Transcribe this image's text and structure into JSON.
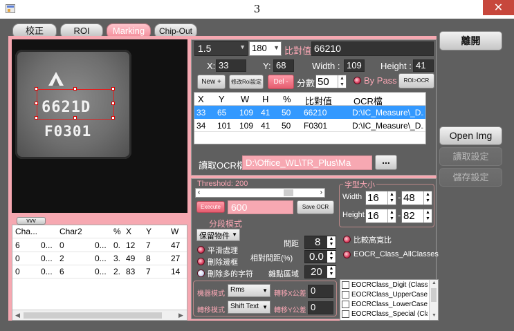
{
  "window": {
    "title": "3",
    "close_glyph": "✕"
  },
  "tabs": [
    {
      "label": "校正",
      "active": false
    },
    {
      "label": "ROI",
      "active": false
    },
    {
      "label": "Marking",
      "active": true
    },
    {
      "label": "Chip-Out",
      "active": false
    }
  ],
  "side_buttons": {
    "exit": "離開",
    "open_img": "Open Img",
    "read_settings": "讀取設定",
    "save_settings": "儲存設定"
  },
  "image": {
    "logo_char": "A",
    "line1": "6621D",
    "line2": "F0301"
  },
  "left_panel": {
    "collapse_label": "vvv",
    "columns": [
      "Cha...",
      "",
      "Char2",
      "",
      "%",
      "X",
      "Y",
      "W"
    ],
    "rows": [
      [
        "6",
        "0...",
        "0",
        "0...",
        "0.",
        "12",
        "7",
        "47"
      ],
      [
        "0",
        "0...",
        "2",
        "0...",
        "3.",
        "49",
        "8",
        "27"
      ],
      [
        "0",
        "0...",
        "6",
        "0...",
        "2.",
        "83",
        "7",
        "14"
      ]
    ]
  },
  "top_panel": {
    "value_dropdown": "1.5",
    "angle_dropdown": "180",
    "compare_label": "比對值",
    "compare_value": "66210",
    "x_label": "X:",
    "x_value": "33",
    "y_label": "Y:",
    "y_value": "68",
    "width_label": "Width :",
    "width_value": "109",
    "height_label": "Height :",
    "height_value": "41",
    "new_button": "New +",
    "modify_roi_button": "修改Roi設定",
    "del_button": "Del -",
    "score_label": "分數",
    "score_value": "50",
    "bypass_label": "By Pass",
    "roi_ocr_button": "ROI>OCR",
    "grid_columns": [
      "X",
      "Y",
      "W",
      "H",
      "%",
      "比對值",
      "OCR檔"
    ],
    "grid_rows": [
      [
        "33",
        "65",
        "109",
        "41",
        "50",
        "66210",
        "D:\\IC_Measure\\_D..."
      ],
      [
        "34",
        "101",
        "109",
        "41",
        "50",
        "F0301",
        "D:\\IC_Measure\\_D..."
      ]
    ],
    "read_ocr_label": "讀取OCR檔",
    "ocr_path": "D:\\Office_WL\\TR_Plus\\Ma",
    "browse_button": "..."
  },
  "bottom_panel": {
    "threshold_label": "Threshold: 200",
    "threshold_fraction": 0.78,
    "execute_button": "Execute",
    "execute_value": "600",
    "save_ocr_button": "Save OCR",
    "font_size_group": "字型大小",
    "width_label": "Width",
    "width_val1": "16",
    "width_val2": "48",
    "height_label": "Height",
    "height_val1": "16",
    "height_val2": "82",
    "segment_mode_label": "分段模式",
    "keep_object_dropdown": "保留物件",
    "smooth_label": "平滑處理",
    "remove_border_label": "刪除邊框",
    "remove_extra_label": "刪除多的字符",
    "spacing_label": "間距",
    "spacing_value": "8",
    "relative_spacing_label": "相對間距(%)",
    "relative_spacing_value": "0.0",
    "noise_area_label": "雜點區域",
    "noise_area_value": "20",
    "compare_height_ratio": "比較高寬比",
    "eocr_all_classes": "EOCR_Class_AllClasses",
    "machine_mode_label": "機器模式",
    "machine_mode_value": "Rms",
    "shift_x_label": "轉移X公差",
    "shift_x_value": "0",
    "shift_mode_label": "轉移模式",
    "shift_mode_value": "Shift Text",
    "shift_y_label": "轉移Y公差",
    "shift_y_value": "0",
    "class_list": [
      "EOCRClass_Digit (Class",
      "EOCRClass_UpperCase",
      "EOCRClass_LowerCase (",
      "EOCRClass_Special (Cla"
    ]
  },
  "colors": {
    "accent_pink": "#f6a8b1",
    "selected_row": "#3399ff",
    "panel_gray": "#5f5f5f"
  }
}
